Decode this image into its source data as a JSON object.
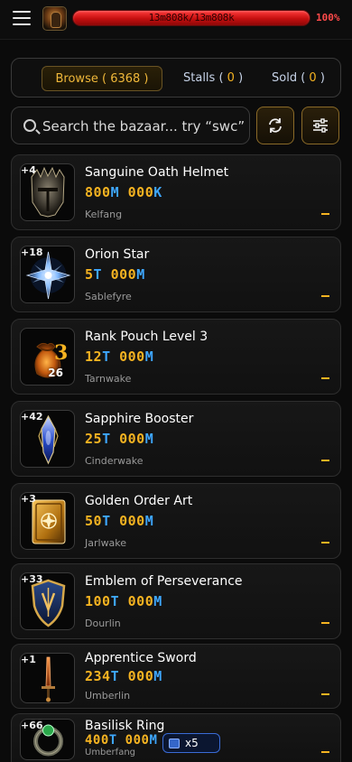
{
  "header": {
    "hp_text": "13m808k/13m808k",
    "hp_percent": "100%",
    "hp_fill": 1.0,
    "bar_color": "#d81a1a"
  },
  "tabs": [
    {
      "label": "Browse (",
      "count": "6368",
      "close": ")"
    },
    {
      "label": "Stalls (",
      "count": "0",
      "close": ")"
    },
    {
      "label": "Sold (",
      "count": "0",
      "close": ")"
    }
  ],
  "search": {
    "placeholder": "Search the bazaar... try “swc”"
  },
  "items": [
    {
      "level": "+4",
      "name": "Sanguine Oath Helmet",
      "price_a": "800",
      "unit_a": "M",
      "price_b": " 000",
      "unit_b": "K",
      "seller": "Kelfang",
      "icon": "helmet-icon"
    },
    {
      "level": "+18",
      "name": "Orion Star",
      "price_a": "5",
      "unit_a": "T",
      "price_b": " 000",
      "unit_b": "M",
      "seller": "Sablefyre",
      "icon": "star-icon"
    },
    {
      "level": "",
      "name": "Rank Pouch Level 3",
      "price_a": "12",
      "unit_a": "T",
      "price_b": " 000",
      "unit_b": "M",
      "seller": "Tarnwake",
      "icon": "pouch-icon",
      "quantity": "26",
      "pouch_rank": "3"
    },
    {
      "level": "+42",
      "name": "Sapphire Booster",
      "price_a": "25",
      "unit_a": "T",
      "price_b": " 000",
      "unit_b": "M",
      "seller": "Cinderwake",
      "icon": "crystal-icon"
    },
    {
      "level": "+3",
      "name": "Golden Order Art",
      "price_a": "50",
      "unit_a": "T",
      "price_b": " 000",
      "unit_b": "M",
      "seller": "Jarlwake",
      "icon": "tome-icon"
    },
    {
      "level": "+33",
      "name": "Emblem of Perseverance",
      "price_a": "100",
      "unit_a": "T",
      "price_b": " 000",
      "unit_b": "M",
      "seller": "Dourlin",
      "icon": "shield-emblem-icon"
    },
    {
      "level": "+1",
      "name": "Apprentice Sword",
      "price_a": "234",
      "unit_a": "T",
      "price_b": " 000",
      "unit_b": "M",
      "seller": "Umberlin",
      "icon": "sword-icon"
    },
    {
      "level": "+66",
      "name": "Basilisk Ring",
      "price_a": "400",
      "unit_a": "T",
      "price_b": " 000",
      "unit_b": "M",
      "seller": "Umberfang",
      "icon": "ring-icon"
    }
  ],
  "multiplier_badge": "x5",
  "colors": {
    "gold": "#f5b321",
    "unit_blue": "#3ea7ff",
    "hp_red": "#ff4a4a"
  }
}
